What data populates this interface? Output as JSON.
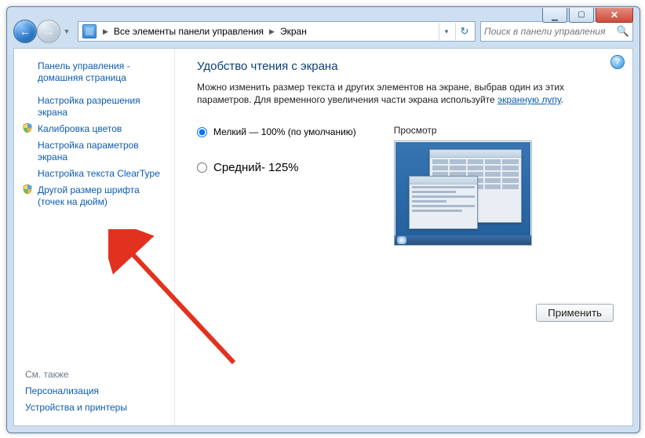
{
  "breadcrumb": {
    "item1": "Все элементы панели управления",
    "item2": "Экран"
  },
  "search": {
    "placeholder": "Поиск в панели управления"
  },
  "sidebar": {
    "home": "Панель управления - домашняя страница",
    "items": [
      "Настройка разрешения экрана",
      "Калибровка цветов",
      "Настройка параметров экрана",
      "Настройка текста ClearType",
      "Другой размер шрифта (точек на дюйм)"
    ],
    "seeAlso": "См. также",
    "related": [
      "Персонализация",
      "Устройства и принтеры"
    ]
  },
  "main": {
    "title": "Удобство чтения с экрана",
    "desc1": "Можно изменить размер текста и других элементов на экране, выбрав один из этих параметров. Для временного увеличения части экрана используйте ",
    "descLink": "экранную лупу",
    "desc2": ".",
    "option1": "Мелкий — 100% (по умолчанию)",
    "option2": "Средний- 125%",
    "previewLabel": "Просмотр",
    "applyLabel": "Применить"
  }
}
